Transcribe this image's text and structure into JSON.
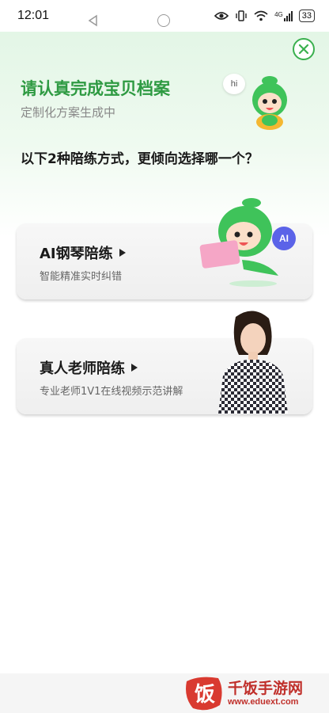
{
  "status_bar": {
    "time": "12:01",
    "signal_label": "4G",
    "battery": "33"
  },
  "header": {
    "title": "请认真完成宝贝档案",
    "subtitle": "定制化方案生成中",
    "hi_bubble": "hi"
  },
  "question": "以下2种陪练方式，更倾向选择哪一个？",
  "options": [
    {
      "title": "AI钢琴陪练",
      "description": "智能精准实时纠错",
      "badge": "AI"
    },
    {
      "title": "真人老师陪练",
      "description": "专业老师1V1在线视频示范讲解"
    }
  ],
  "watermark": {
    "title": "千饭手游网",
    "url": "www.eduext.com",
    "logo_char": "饭"
  },
  "colors": {
    "brand_green": "#2e9a42",
    "close_green": "#3ab04e",
    "ai_badge": "#5b63e8",
    "watermark_red": "#c0302b"
  },
  "icons": [
    "eye-icon",
    "vibrate-icon",
    "wifi-icon",
    "signal-icon",
    "battery-icon",
    "close-icon",
    "play-icon",
    "back-icon",
    "home-icon"
  ]
}
